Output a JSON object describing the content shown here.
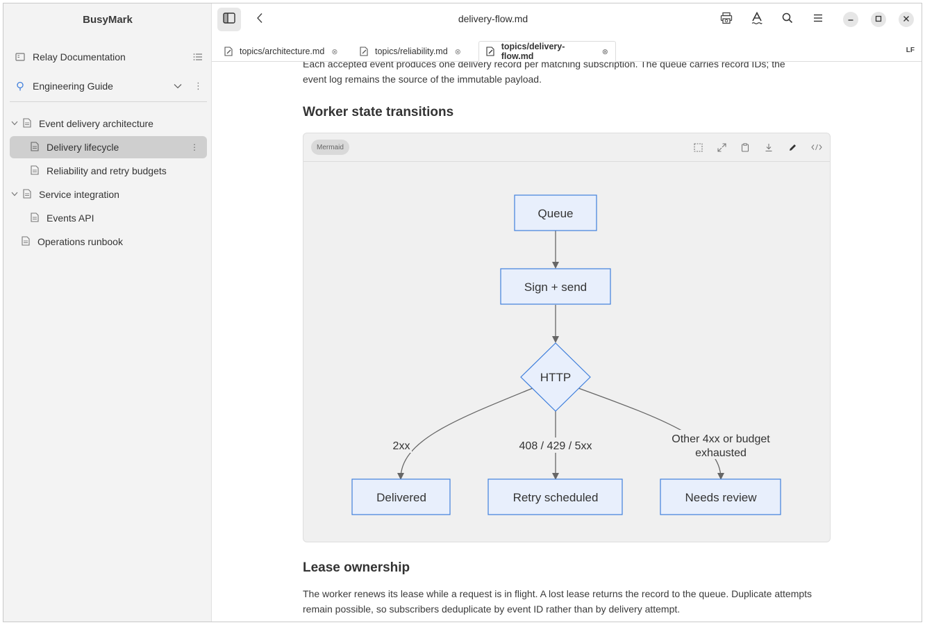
{
  "app": {
    "name": "BusyMark"
  },
  "sidebar": {
    "workspace": "Relay Documentation",
    "guide": "Engineering Guide",
    "tree": [
      {
        "label": "Event delivery architecture"
      },
      {
        "label": "Delivery lifecycle"
      },
      {
        "label": "Reliability and retry budgets"
      },
      {
        "label": "Service integration"
      },
      {
        "label": "Events API"
      },
      {
        "label": "Operations runbook"
      }
    ]
  },
  "header": {
    "title": "delivery-flow.md"
  },
  "tabs": [
    {
      "label": "topics/architecture.md"
    },
    {
      "label": "topics/reliability.md"
    },
    {
      "label": "topics/delivery-flow.md"
    }
  ],
  "status": {
    "line_ending": "LF"
  },
  "content": {
    "intro": "Each accepted event produces one delivery record per matching subscription. The queue carries record IDs; the event log remains the source of the immutable payload.",
    "heading_worker": "Worker state transitions",
    "mermaid_badge": "Mermaid",
    "diagram": {
      "queue": "Queue",
      "sign": "Sign + send",
      "http": "HTTP",
      "delivered": "Delivered",
      "retry": "Retry scheduled",
      "review": "Needs review",
      "edge_2xx": "2xx",
      "edge_retry": "408 / 429 / 5xx",
      "edge_other_1": "Other 4xx or budget",
      "edge_other_2": "exhausted"
    },
    "heading_lease": "Lease ownership",
    "lease_text": "The worker renews its lease while a request is in flight. A lost lease returns the record to the queue. Duplicate attempts remain possible, so subscribers deduplicate by event ID rather than by delivery attempt."
  },
  "colors": {
    "node_fill": "#e8effc",
    "node_stroke": "#3f7fdc",
    "edge": "#666666",
    "sidebar_bg": "#f3f3f3",
    "selected_bg": "#cfcfcf"
  },
  "icons": {
    "sidebar_toggle": "sidebar-toggle-icon",
    "back": "chevron-left-icon",
    "print": "print-preview-icon",
    "font": "font-icon",
    "search": "search-icon",
    "menu": "hamburger-icon",
    "minimize": "minimize-icon",
    "maximize": "maximize-icon",
    "close": "close-icon"
  }
}
